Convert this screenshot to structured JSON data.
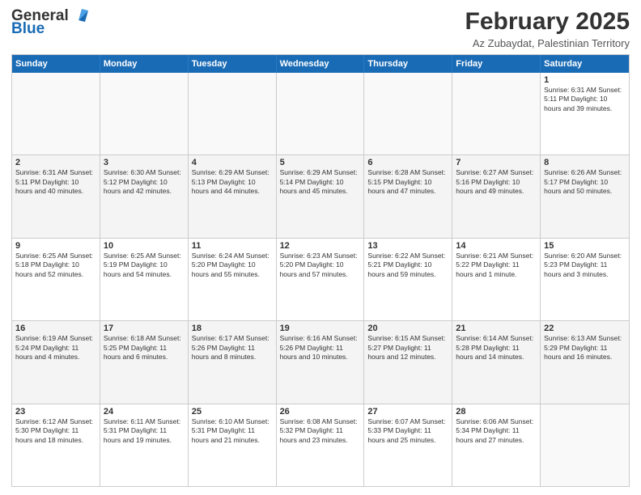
{
  "header": {
    "logo_line1": "General",
    "logo_line2": "Blue",
    "month_year": "February 2025",
    "location": "Az Zubaydat, Palestinian Territory"
  },
  "days_of_week": [
    "Sunday",
    "Monday",
    "Tuesday",
    "Wednesday",
    "Thursday",
    "Friday",
    "Saturday"
  ],
  "rows": [
    [
      {
        "day": "",
        "info": ""
      },
      {
        "day": "",
        "info": ""
      },
      {
        "day": "",
        "info": ""
      },
      {
        "day": "",
        "info": ""
      },
      {
        "day": "",
        "info": ""
      },
      {
        "day": "",
        "info": ""
      },
      {
        "day": "1",
        "info": "Sunrise: 6:31 AM\nSunset: 5:11 PM\nDaylight: 10 hours and 39 minutes."
      }
    ],
    [
      {
        "day": "2",
        "info": "Sunrise: 6:31 AM\nSunset: 5:11 PM\nDaylight: 10 hours and 40 minutes."
      },
      {
        "day": "3",
        "info": "Sunrise: 6:30 AM\nSunset: 5:12 PM\nDaylight: 10 hours and 42 minutes."
      },
      {
        "day": "4",
        "info": "Sunrise: 6:29 AM\nSunset: 5:13 PM\nDaylight: 10 hours and 44 minutes."
      },
      {
        "day": "5",
        "info": "Sunrise: 6:29 AM\nSunset: 5:14 PM\nDaylight: 10 hours and 45 minutes."
      },
      {
        "day": "6",
        "info": "Sunrise: 6:28 AM\nSunset: 5:15 PM\nDaylight: 10 hours and 47 minutes."
      },
      {
        "day": "7",
        "info": "Sunrise: 6:27 AM\nSunset: 5:16 PM\nDaylight: 10 hours and 49 minutes."
      },
      {
        "day": "8",
        "info": "Sunrise: 6:26 AM\nSunset: 5:17 PM\nDaylight: 10 hours and 50 minutes."
      }
    ],
    [
      {
        "day": "9",
        "info": "Sunrise: 6:25 AM\nSunset: 5:18 PM\nDaylight: 10 hours and 52 minutes."
      },
      {
        "day": "10",
        "info": "Sunrise: 6:25 AM\nSunset: 5:19 PM\nDaylight: 10 hours and 54 minutes."
      },
      {
        "day": "11",
        "info": "Sunrise: 6:24 AM\nSunset: 5:20 PM\nDaylight: 10 hours and 55 minutes."
      },
      {
        "day": "12",
        "info": "Sunrise: 6:23 AM\nSunset: 5:20 PM\nDaylight: 10 hours and 57 minutes."
      },
      {
        "day": "13",
        "info": "Sunrise: 6:22 AM\nSunset: 5:21 PM\nDaylight: 10 hours and 59 minutes."
      },
      {
        "day": "14",
        "info": "Sunrise: 6:21 AM\nSunset: 5:22 PM\nDaylight: 11 hours and 1 minute."
      },
      {
        "day": "15",
        "info": "Sunrise: 6:20 AM\nSunset: 5:23 PM\nDaylight: 11 hours and 3 minutes."
      }
    ],
    [
      {
        "day": "16",
        "info": "Sunrise: 6:19 AM\nSunset: 5:24 PM\nDaylight: 11 hours and 4 minutes."
      },
      {
        "day": "17",
        "info": "Sunrise: 6:18 AM\nSunset: 5:25 PM\nDaylight: 11 hours and 6 minutes."
      },
      {
        "day": "18",
        "info": "Sunrise: 6:17 AM\nSunset: 5:26 PM\nDaylight: 11 hours and 8 minutes."
      },
      {
        "day": "19",
        "info": "Sunrise: 6:16 AM\nSunset: 5:26 PM\nDaylight: 11 hours and 10 minutes."
      },
      {
        "day": "20",
        "info": "Sunrise: 6:15 AM\nSunset: 5:27 PM\nDaylight: 11 hours and 12 minutes."
      },
      {
        "day": "21",
        "info": "Sunrise: 6:14 AM\nSunset: 5:28 PM\nDaylight: 11 hours and 14 minutes."
      },
      {
        "day": "22",
        "info": "Sunrise: 6:13 AM\nSunset: 5:29 PM\nDaylight: 11 hours and 16 minutes."
      }
    ],
    [
      {
        "day": "23",
        "info": "Sunrise: 6:12 AM\nSunset: 5:30 PM\nDaylight: 11 hours and 18 minutes."
      },
      {
        "day": "24",
        "info": "Sunrise: 6:11 AM\nSunset: 5:31 PM\nDaylight: 11 hours and 19 minutes."
      },
      {
        "day": "25",
        "info": "Sunrise: 6:10 AM\nSunset: 5:31 PM\nDaylight: 11 hours and 21 minutes."
      },
      {
        "day": "26",
        "info": "Sunrise: 6:08 AM\nSunset: 5:32 PM\nDaylight: 11 hours and 23 minutes."
      },
      {
        "day": "27",
        "info": "Sunrise: 6:07 AM\nSunset: 5:33 PM\nDaylight: 11 hours and 25 minutes."
      },
      {
        "day": "28",
        "info": "Sunrise: 6:06 AM\nSunset: 5:34 PM\nDaylight: 11 hours and 27 minutes."
      },
      {
        "day": "",
        "info": ""
      }
    ]
  ]
}
